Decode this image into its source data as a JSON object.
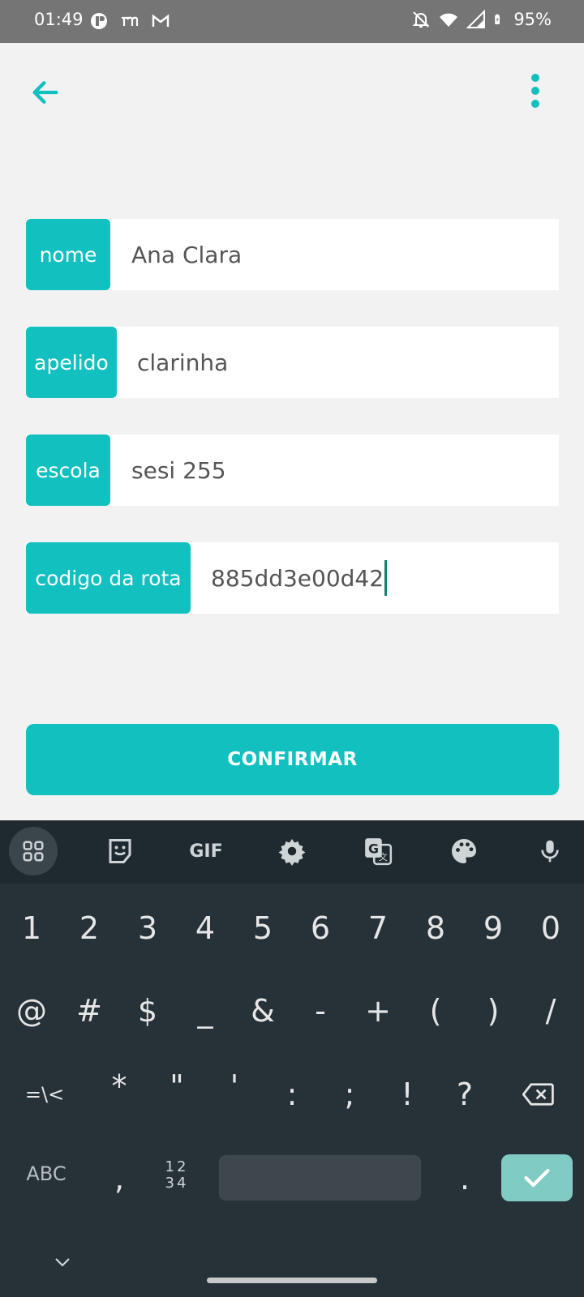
{
  "status_bar": {
    "time": "01:49",
    "battery": "95%",
    "icons_left": [
      "recording-icon",
      "tm-app-icon",
      "gmail-icon"
    ],
    "icons_right": [
      "silent-bell-icon",
      "wifi-icon",
      "signal-icon",
      "battery-charging-icon"
    ]
  },
  "app_bar": {
    "back_icon": "arrow-back-icon",
    "more_icon": "more-vertical-icon",
    "accent": "#12c0c0"
  },
  "form": {
    "fields": [
      {
        "label": "nome",
        "value": "Ana Clara"
      },
      {
        "label": "apelido",
        "value": "clarinha"
      },
      {
        "label": "escola",
        "value": "sesi 255"
      },
      {
        "label": "codigo da rota",
        "value": "885dd3e00d42"
      }
    ],
    "confirm_label": "CONFIRMAR"
  },
  "keyboard": {
    "toolbar": [
      "apps-grid-icon",
      "sticker-icon",
      "GIF",
      "settings-icon",
      "translate-icon",
      "palette-icon",
      "mic-icon"
    ],
    "row1": [
      "1",
      "2",
      "3",
      "4",
      "5",
      "6",
      "7",
      "8",
      "9",
      "0"
    ],
    "row2": [
      "@",
      "#",
      "$",
      "_",
      "&",
      "-",
      "+",
      "(",
      ")",
      "/"
    ],
    "row3": [
      "=\\<",
      "*",
      "\"",
      "'",
      ":",
      ";",
      "!",
      "?"
    ],
    "row4": {
      "abc": "ABC",
      "comma": ",",
      "numpad_top": "12",
      "numpad_bottom": "34",
      "period": "."
    },
    "colors": {
      "toolbar": "#1f2a30",
      "body": "#273238",
      "enter": "#80cbc4"
    }
  }
}
